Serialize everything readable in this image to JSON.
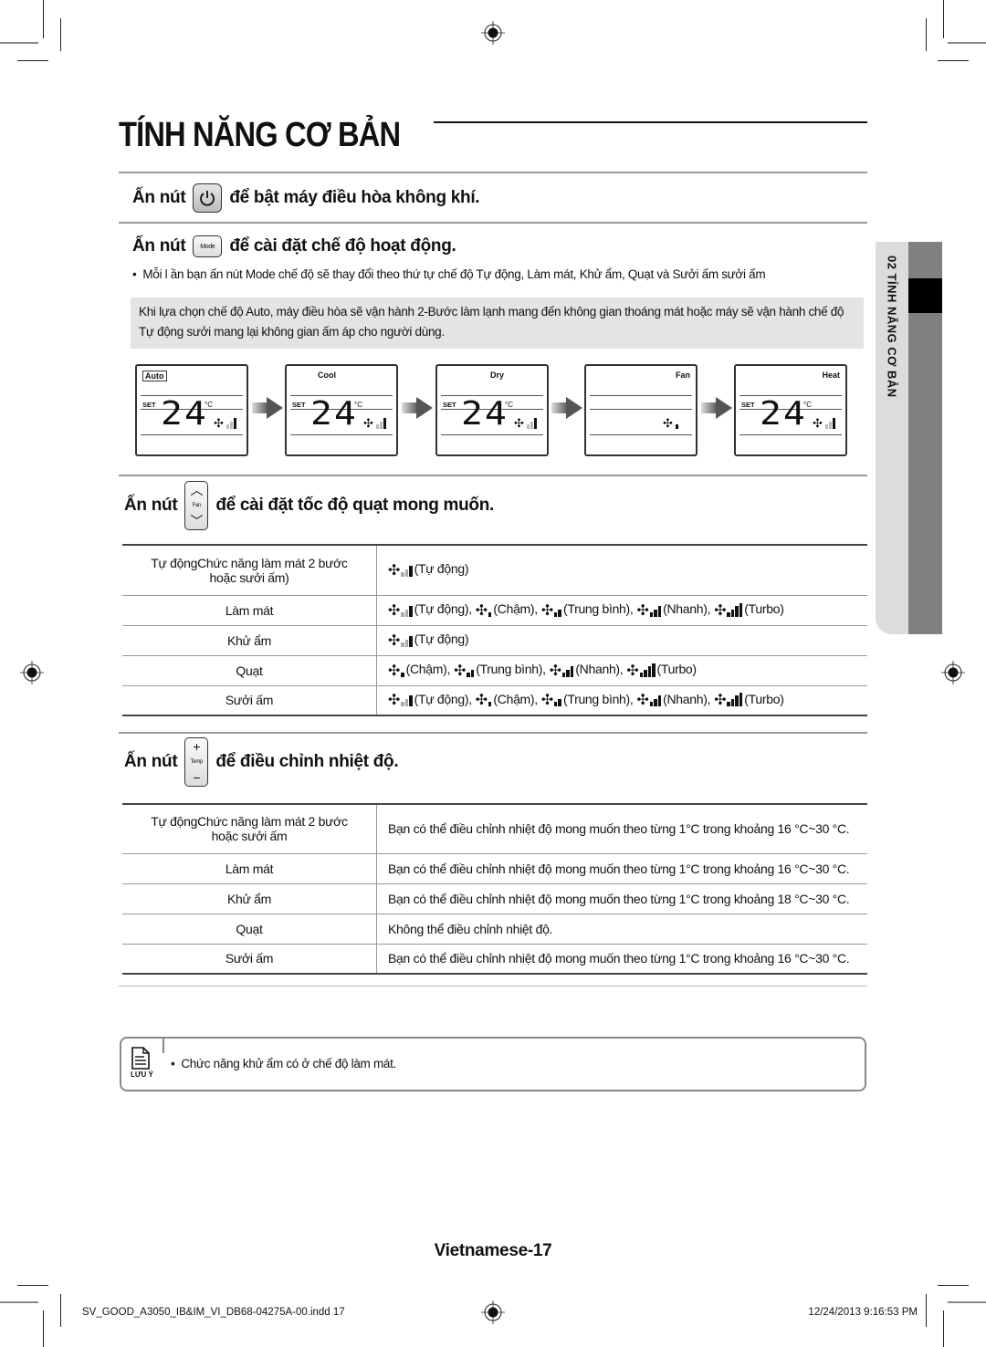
{
  "page": {
    "title": "TÍNH NĂNG CƠ BẢN",
    "side_tab": "02  TÍNH NĂNG CƠ BẢN",
    "page_number": "Vietnamese-17"
  },
  "section_power": {
    "prefix": "Ấn nút",
    "suffix": "để bật máy điều hòa không khí.",
    "button_icon": "power-icon"
  },
  "section_mode": {
    "prefix": "Ấn nút",
    "button_label": "Mode",
    "suffix": "để cài đặt chế độ hoạt động.",
    "bullet": "Mỗi l ần bạn ấn nút Mode chế độ sẽ thay đổi theo thứ tự chế độ Tự động, Làm mát, Khử ẩm, Quạt và Sưởi ấm sưởi ấm",
    "note": "Khi lựa chọn chế độ Auto, máy điều hòa sẽ vận hành 2-Bước làm lạnh mang đến không gian thoáng mát hoặc máy sẽ vận hành chế độ Tự động sưởi mang lại không gian ấm áp cho người dùng.",
    "displays": [
      {
        "mode": "Auto",
        "set": "SET",
        "temp": "24",
        "unit": "°C",
        "fan_level": "auto"
      },
      {
        "mode": "Cool",
        "set": "SET",
        "temp": "24",
        "unit": "°C",
        "fan_level": "auto"
      },
      {
        "mode": "Dry",
        "set": "SET",
        "temp": "24",
        "unit": "°C",
        "fan_level": "auto"
      },
      {
        "mode": "Fan",
        "set": "",
        "temp": "",
        "unit": "",
        "fan_level": "low"
      },
      {
        "mode": "Heat",
        "set": "SET",
        "temp": "24",
        "unit": "°C",
        "fan_level": "auto"
      }
    ]
  },
  "section_fan": {
    "prefix": "Ấn nút",
    "button_label": "Fan",
    "suffix": "để cài đặt tốc độ quạt mong muốn.",
    "rows": [
      {
        "mode": "Tự độngChức năng làm mát 2 bước hoặc sưởi ấm)",
        "speeds": [
          {
            "level": "auto",
            "label": "(Tự động)"
          }
        ]
      },
      {
        "mode": "Làm mát",
        "speeds": [
          {
            "level": "auto",
            "label": "(Tự động),"
          },
          {
            "level": "low",
            "label": "(Chậm),"
          },
          {
            "level": "mid",
            "label": "(Trung bình),"
          },
          {
            "level": "high",
            "label": "(Nhanh),"
          },
          {
            "level": "turbo",
            "label": "(Turbo)"
          }
        ]
      },
      {
        "mode": "Khử ẩm",
        "speeds": [
          {
            "level": "auto",
            "label": "(Tự động)"
          }
        ]
      },
      {
        "mode": "Quạt",
        "speeds": [
          {
            "level": "low",
            "label": "(Chậm),"
          },
          {
            "level": "mid",
            "label": "(Trung bình),"
          },
          {
            "level": "high",
            "label": "(Nhanh),"
          },
          {
            "level": "turbo",
            "label": "(Turbo)"
          }
        ]
      },
      {
        "mode": "Sưởi ấm",
        "speeds": [
          {
            "level": "auto",
            "label": "(Tự động),"
          },
          {
            "level": "low",
            "label": "(Chậm),"
          },
          {
            "level": "mid",
            "label": "(Trung bình),"
          },
          {
            "level": "high",
            "label": "(Nhanh),"
          },
          {
            "level": "turbo",
            "label": "(Turbo)"
          }
        ]
      }
    ]
  },
  "section_temp": {
    "prefix": "Ấn nút",
    "button_label": "Temp",
    "button_plus": "+",
    "button_minus": "−",
    "suffix": "để điều chỉnh nhiệt độ.",
    "rows": [
      {
        "mode": "Tự độngChức năng làm mát 2 bước hoặc sưởi ấm",
        "desc": "Bạn có thể điều chỉnh nhiệt độ mong muốn theo từng 1°C trong khoảng 16 °C~30 °C."
      },
      {
        "mode": "Làm mát",
        "desc": "Bạn có thể điều chỉnh nhiệt độ mong muốn theo từng 1°C trong khoảng 16 °C~30 °C."
      },
      {
        "mode": "Khử ẩm",
        "desc": "Bạn có thể điều chỉnh nhiệt độ mong muốn theo từng 1°C trong khoảng 18 °C~30 °C."
      },
      {
        "mode": "Quạt",
        "desc": "Không thể điều chỉnh nhiệt độ."
      },
      {
        "mode": "Sưởi ấm",
        "desc": "Bạn có thể điều chỉnh nhiệt độ mong muốn theo từng 1°C trong khoảng 16 °C~30 °C."
      }
    ]
  },
  "note": {
    "label": "LƯU Ý",
    "text": "Chức năng khử ẩm có ở chế độ làm mát."
  },
  "slug": {
    "file": "SV_GOOD_A3050_IB&IM_VI_DB68-04275A-00.indd   17",
    "timestamp": "12/24/2013   9:16:53 PM"
  }
}
